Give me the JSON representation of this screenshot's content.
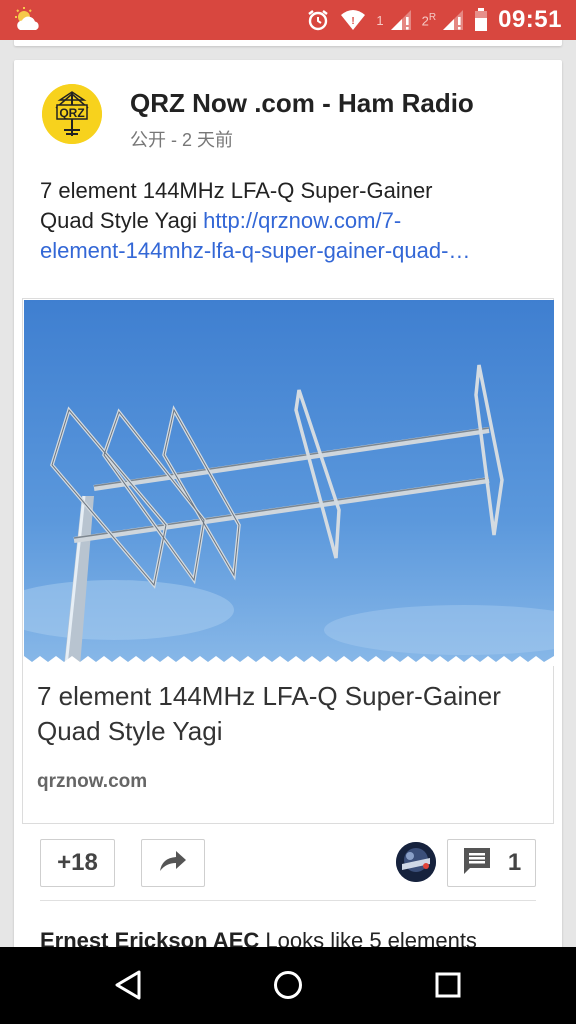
{
  "status_bar": {
    "time": "09:51",
    "sim1_label": "1",
    "sim2_label": "2",
    "sim2_roaming": "R",
    "icons": [
      "weather-partly-cloudy-icon",
      "alarm-icon",
      "wifi-icon",
      "signal-icon",
      "battery-icon"
    ],
    "background_color": "#d8473f"
  },
  "post": {
    "author": "QRZ Now .com - Ham Radio",
    "meta": "公开 - 2 天前",
    "avatar_text": "QRZ",
    "text_line1": "7 element 144MHz LFA-Q Super-Gainer",
    "text_line2_plain": "Quad Style Yagi ",
    "link_part1": "http://qrznow.com/7-",
    "link_part2": "element-144mhz-lfa-q-super-gainer-quad-…",
    "link_color": "#3367d6"
  },
  "link_card": {
    "title": "7 element 144MHz LFA-Q Super-Gainer Quad Style Yagi",
    "domain": "qrznow.com",
    "image": "yagi-antenna-photo"
  },
  "actions": {
    "plus_one_count": "+18",
    "comment_count": "1"
  },
  "comment_preview": {
    "author": "Ernest Erickson AEC",
    "text": " Looks like 5 elements"
  },
  "nav": {
    "icons": [
      "back-icon",
      "home-icon",
      "recents-icon"
    ]
  }
}
